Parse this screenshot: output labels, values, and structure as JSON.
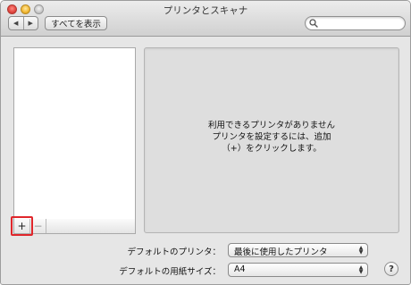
{
  "window": {
    "title": "プリンタとスキャナ"
  },
  "toolbar": {
    "back_icon": "◀",
    "forward_icon": "▶",
    "show_all_label": "すべてを表示",
    "search_placeholder": ""
  },
  "printer_list": {
    "items": [],
    "add_label": "+",
    "remove_label": "−"
  },
  "detail": {
    "message_lines": [
      "利用できるプリンタがありません",
      "プリンタを設定するには、追加",
      "（+）をクリックします。"
    ]
  },
  "settings": {
    "default_printer_label": "デフォルトのプリンタ：",
    "default_printer_value": "最後に使用したプリンタ",
    "default_paper_label": "デフォルトの用紙サイズ：",
    "default_paper_value": "A4"
  },
  "help": {
    "label": "?"
  },
  "colors": {
    "highlight": "#e0262b",
    "window_bg": "#e6e6e6"
  }
}
